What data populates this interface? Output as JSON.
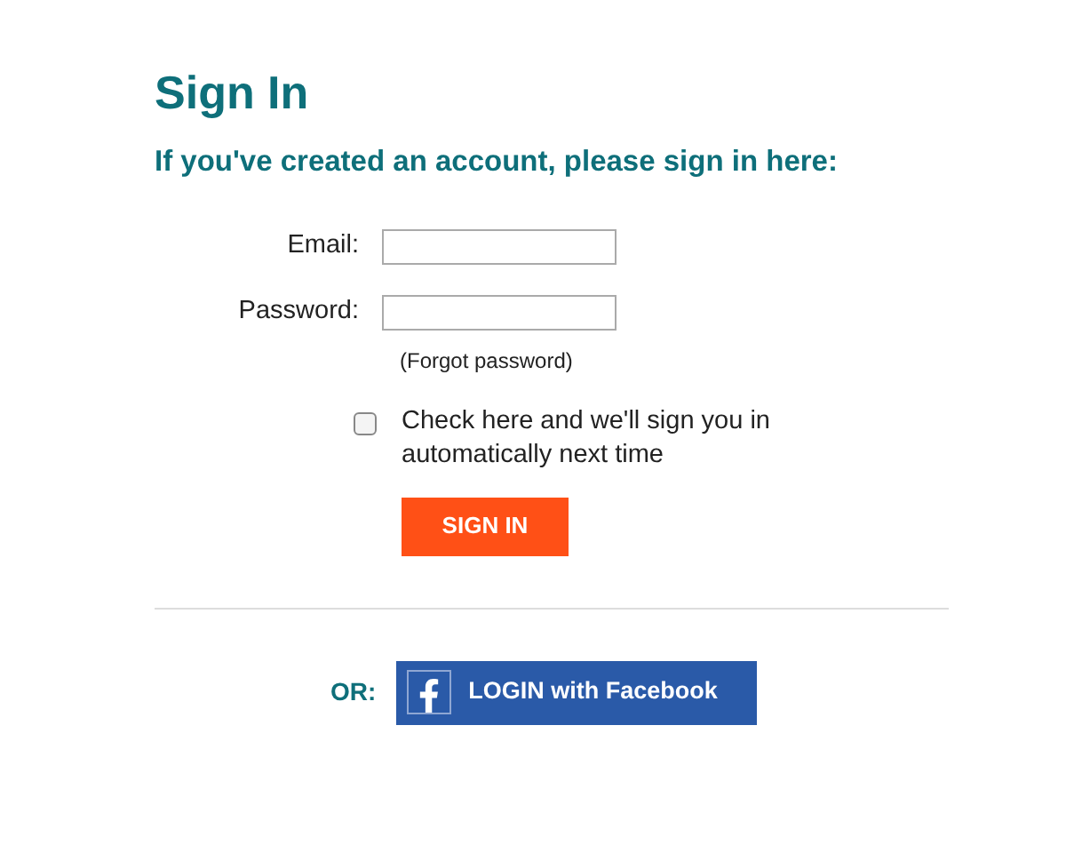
{
  "title": "Sign In",
  "subtitle": "If you've created an account, please sign in here:",
  "fields": [
    {
      "label": "Email:"
    },
    {
      "label": "Password:"
    }
  ],
  "forgot_link": "(Forgot password)",
  "remember": {
    "label": "Check here and we'll sign you in automatically next time",
    "checked": false
  },
  "sign_in_button": "SIGN IN",
  "or_label": "OR:",
  "facebook_button": "LOGIN with Facebook"
}
